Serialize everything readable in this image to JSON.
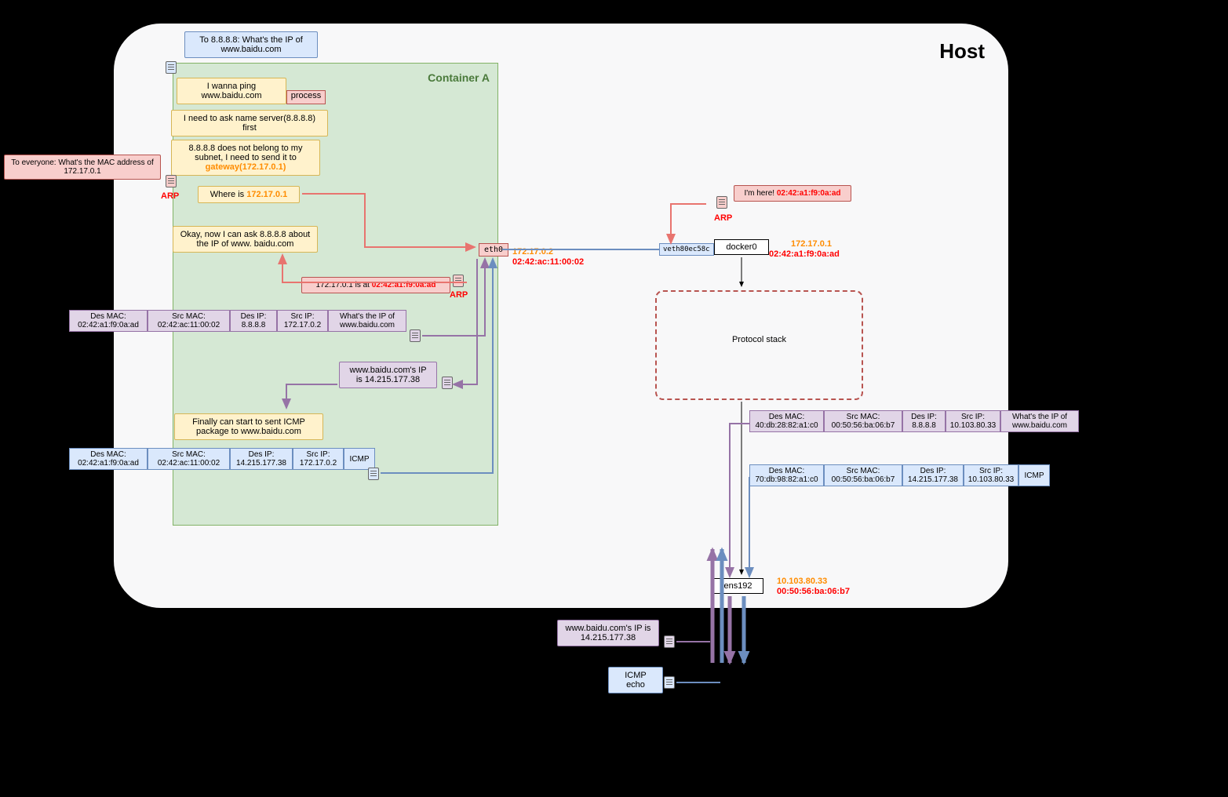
{
  "host": {
    "title": "Host"
  },
  "container": {
    "title": "Container A",
    "process": "process"
  },
  "speech": {
    "to8888": "To 8.8.8.8: What's the IP of www.baidu.com",
    "wanna_ping": "I wanna ping www.baidu.com",
    "need_ask": "I need to ask name server(8.8.8.8) first",
    "not_subnet": "8.8.8.8 does not belong to my subnet, I need to send it to ",
    "gateway": "gateway(172.17.0.1)",
    "to_everyone": "To everyone: What's the MAC address of 172.17.0.1",
    "where_is": "Where is ",
    "where_is_ip": "172.17.0.1",
    "okay_ask": "Okay, now I can ask 8.8.8.8 about the IP of www. baidu.com",
    "im_here": "I'm here! ",
    "im_here_mac": "02:42:a1:f9:0a:ad",
    "is_at": "172.17.0.1 is at ",
    "is_at_mac": "02:42:a1:f9:0a:ad",
    "baidu_ip": "www.baidu.com's IP is 14.215.177.38",
    "finally": "Finally can start to sent ICMP package to www.baidu.com",
    "icmp_echo": "ICMP echo"
  },
  "labels": {
    "arp": "ARP",
    "eth0": "eth0",
    "eth0_ip": "172.17.0.2",
    "eth0_mac": "02:42:ac:11:00:02",
    "veth": "veth80ec58c",
    "docker0": "docker0",
    "docker0_ip": "172.17.0.1",
    "docker0_mac": "02:42:a1:f9:0a:ad",
    "protocol": "Protocol stack",
    "ens192": "ens192",
    "ens192_ip": "10.103.80.33",
    "ens192_mac": "00:50:56:ba:06:b7"
  },
  "packet1": {
    "des_mac": "Des MAC:",
    "des_mac_v": "02:42:a1:f9:0a:ad",
    "src_mac": "Src MAC:",
    "src_mac_v": "02:42:ac:11:00:02",
    "des_ip": "Des IP:",
    "des_ip_v": "8.8.8.8",
    "src_ip": "Src IP:",
    "src_ip_v": "172.17.0.2",
    "payload": "What's the IP of www.baidu.com"
  },
  "packet2": {
    "des_mac": "Des MAC:",
    "des_mac_v": "02:42:a1:f9:0a:ad",
    "src_mac": "Src MAC:",
    "src_mac_v": "02:42:ac:11:00:02",
    "des_ip": "Des IP:",
    "des_ip_v": "14.215.177.38",
    "src_ip": "Src IP:",
    "src_ip_v": "172.17.0.2",
    "payload": "ICMP"
  },
  "packet3": {
    "des_mac": "Des MAC:",
    "des_mac_v": "40:db:28:82:a1:c0",
    "src_mac": "Src MAC:",
    "src_mac_v": "00:50:56:ba:06:b7",
    "des_ip": "Des IP:",
    "des_ip_v": "8.8.8.8",
    "src_ip": "Src IP:",
    "src_ip_v": "10.103.80.33",
    "payload": "What's the IP of www.baidu.com"
  },
  "packet4": {
    "des_mac": "Des MAC:",
    "des_mac_v": "70:db:98:82:a1:c0",
    "src_mac": "Src MAC:",
    "src_mac_v": "00:50:56:ba:06:b7",
    "des_ip": "Des IP:",
    "des_ip_v": "14.215.177.38",
    "src_ip": "Src IP:",
    "src_ip_v": "10.103.80.33",
    "payload": "ICMP"
  }
}
